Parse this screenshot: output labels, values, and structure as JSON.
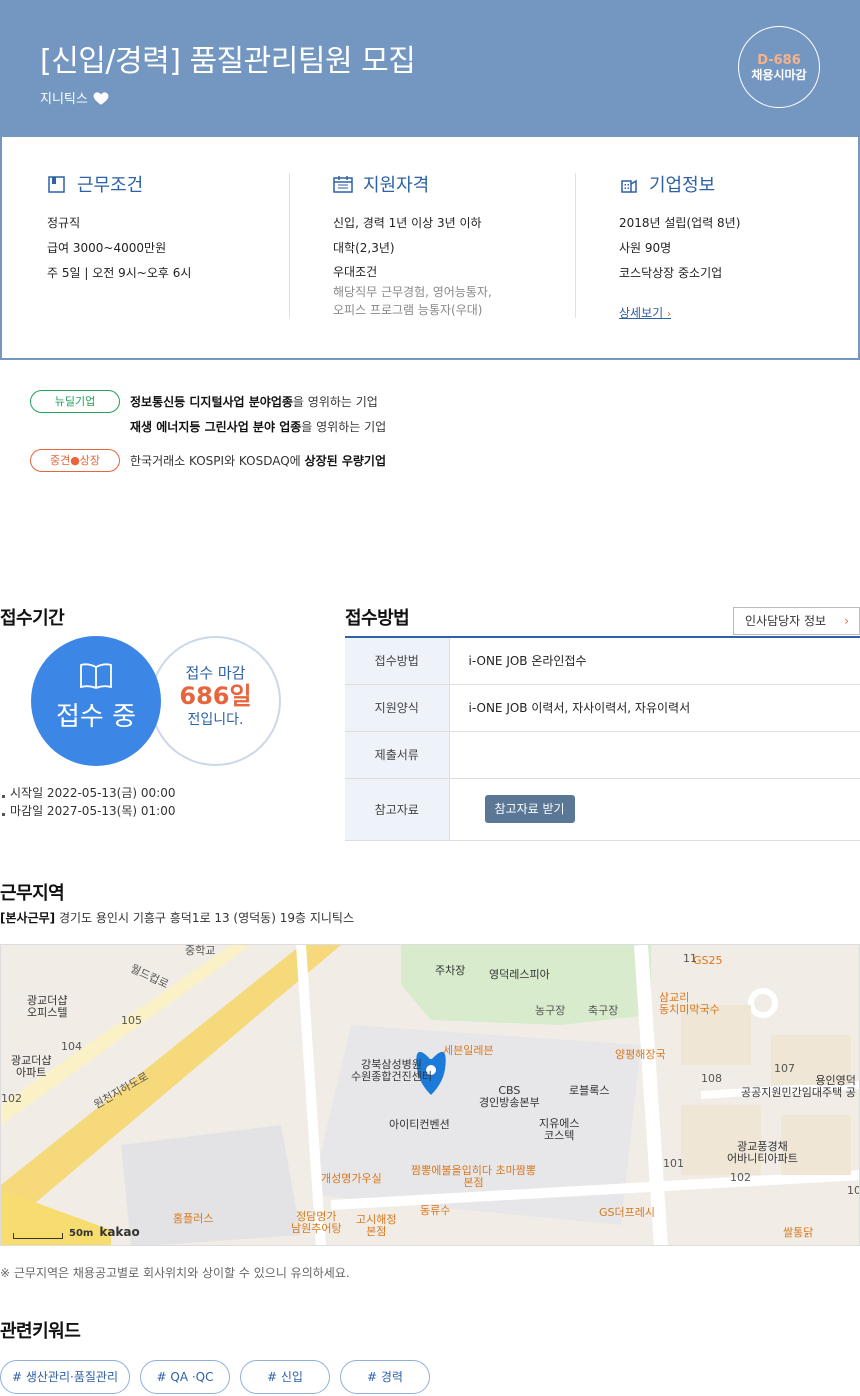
{
  "header": {
    "title": "[신입/경력] 품질관리팀원 모집",
    "company": "지니틱스",
    "dday": "D-686",
    "dday_status": "채용시마감"
  },
  "summary": {
    "work": {
      "title": "근무조건",
      "lines": [
        "정규직",
        "급여 3000~4000만원",
        "주 5일 | 오전 9시~오후 6시"
      ]
    },
    "qualification": {
      "title": "지원자격",
      "lines": [
        "신입, 경력 1년 이상 3년 이하",
        "대학(2,3년)",
        "우대조건"
      ],
      "preferred": [
        "해당직무 근무경험, 영어능통자,",
        "오피스 프로그램 능통자(우대)"
      ]
    },
    "company_info": {
      "title": "기업정보",
      "lines": [
        "2018년 설립(업력 8년)",
        "사원 90명",
        "코스닥상장 중소기업"
      ],
      "more_label": "상세보기"
    }
  },
  "company_tags": [
    {
      "pill": "뉴딜기업",
      "color": "#23a05a",
      "lines": [
        {
          "bold": "정보통신등 디지털사업 분야업종",
          "rest": "을 영위하는 기업"
        },
        {
          "bold": "재생 에너지등 그린사업 분야 업종",
          "rest": "을 영위하는 기업"
        }
      ]
    },
    {
      "pill": "중견●상장",
      "color": "#e7643c",
      "lines": [
        {
          "pre": "한국거래소 KOSPI와 KOSDAQ에 ",
          "bold": "상장된 우량기업"
        }
      ]
    }
  ],
  "period": {
    "heading": "접수기간",
    "status": "접수 중",
    "deadline_pre": "접수 마감",
    "deadline_days": "686일",
    "deadline_post": "전입니다.",
    "start": "시작일 2022-05-13(금) 00:00",
    "end": "마감일 2027-05-13(목) 01:00"
  },
  "method": {
    "heading": "접수방법",
    "hr_button": "인사담당자 정보",
    "rows": [
      {
        "key": "접수방법",
        "value": "i-ONE JOB 온라인접수"
      },
      {
        "key": "지원양식",
        "value": "i-ONE JOB 이력서, 자사이력서, 자유이력서"
      },
      {
        "key": "제출서류",
        "value": ""
      },
      {
        "key": "참고자료",
        "button": "참고자료 받기"
      }
    ]
  },
  "location": {
    "heading": "근무지역",
    "address_tag": "[본사근무]",
    "address": " 경기도 용인시 기흥구 흥덕1로 13 (영덕동) 19층 지니틱스",
    "notice": "※ 근무지역은 채용공고별로 회사위치와 상이할 수 있으니 유의하세요.",
    "map_labels": {
      "a": "중학교",
      "b": "월드컵로",
      "c": "광교더샵\n오피스텔",
      "d": "105",
      "e": "104",
      "f": "광교더샵\n아파트",
      "g": "102",
      "h": "원천지하도로",
      "i": "주차장",
      "j": "영덕레스피아",
      "k": "농구장",
      "l": "축구장",
      "m": "GS25",
      "n": "11",
      "o": "삼교리\n동치미막국수",
      "p": "양평해장국",
      "q": "세븐일레븐",
      "r": "강북삼성병원\n수원종합건진센터",
      "s": "CBS\n경인방송본부",
      "t": "로블록스",
      "u": "아이티컨벤션",
      "v": "지유에스\n코스텍",
      "w": "107",
      "x": "108",
      "y": "용인영덕\n공공지원민간임대주택 공",
      "z": "광교풍경채\n어바니티아파트",
      "aa": "101",
      "ab": "102",
      "ac": "10",
      "ad": "개성명가우실",
      "ae": "짬뽕에불을입히다 초마짬뽕\n본점",
      "af": "홈플러스",
      "ag": "정담명가\n남원추어탕",
      "ah": "고시해정\n본점",
      "ai": "동류수",
      "aj": "GS더프레시",
      "ak": "쌀통닭",
      "scale": "50m",
      "brand": "kakao"
    }
  },
  "keywords": {
    "heading": "관련키워드",
    "items": [
      "# 생산관리·품질관리",
      "# QA ·QC",
      "# 신입",
      "# 경력"
    ]
  }
}
